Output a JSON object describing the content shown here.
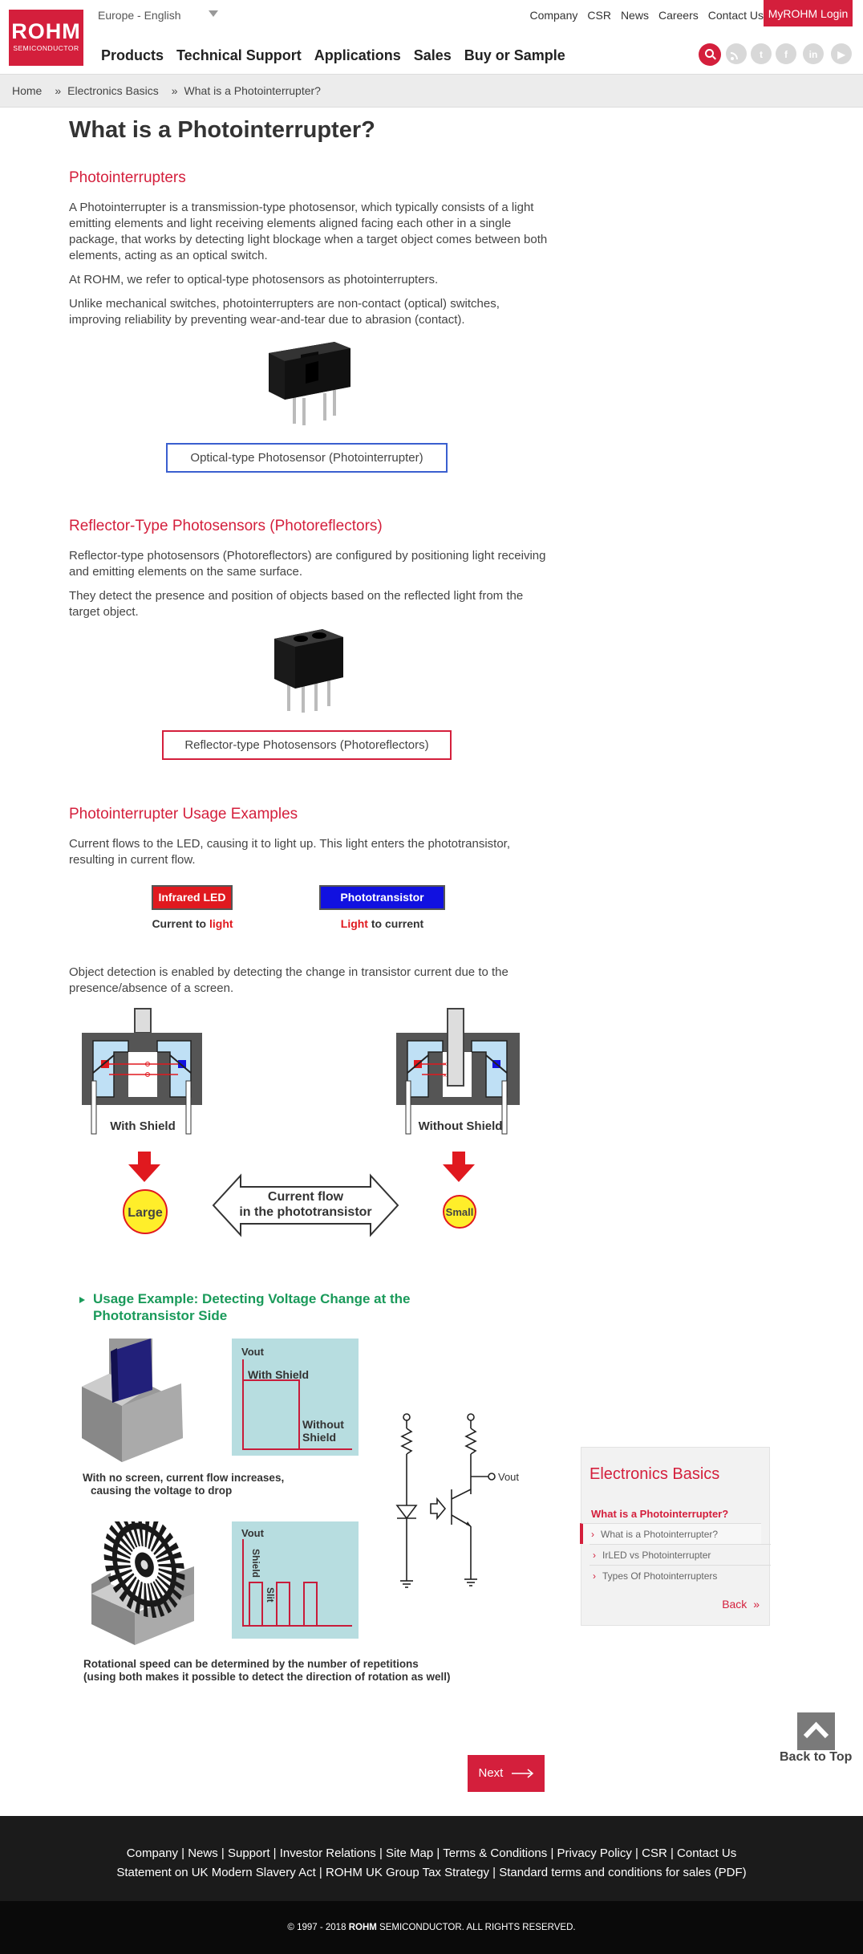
{
  "header": {
    "logo": {
      "brand": "ROHM",
      "sub": "SEMICONDUCTOR"
    },
    "region": "Europe - English",
    "top_links": [
      "Company",
      "CSR",
      "News",
      "Careers",
      "Contact Us"
    ],
    "login": "MyROHM Login",
    "nav": [
      "Products",
      "Technical Support",
      "Applications",
      "Sales",
      "Buy or Sample"
    ],
    "icons": [
      "search-icon",
      "rss-icon",
      "twitter-icon",
      "facebook-icon",
      "linkedin-icon",
      "youtube-icon"
    ]
  },
  "breadcrumb": [
    "Home",
    "»",
    "Electronics Basics",
    "»",
    "What is a Photointerrupter?"
  ],
  "page": {
    "title": "What is a Photointerrupter?",
    "s1": {
      "title": "Photointerrupters",
      "p1": "A Photointerrupter is a transmission-type photosensor, which typically consists of a light emitting elements and light receiving elements aligned facing each other in a single package, that works by detecting light blockage when a target object comes between both elements, acting as an optical switch.",
      "p2": "At ROHM, we refer to optical-type photosensors as photointerrupters.",
      "p3": "Unlike mechanical switches, photointerrupters are non-contact (optical) switches, improving reliability by preventing wear-and-tear due to abrasion (contact).",
      "caption": "Optical-type Photosensor (Photointerrupter)"
    },
    "s2": {
      "title": "Reflector-Type Photosensors (Photoreflectors)",
      "p1": "Reflector-type photosensors (Photoreflectors) are configured by positioning light receiving and emitting elements on the same surface.",
      "p2": "They detect the presence and position of objects based on the reflected light from the target object.",
      "caption": "Reflector-type Photosensors (Photoreflectors)"
    },
    "s3": {
      "title": "Photointerrupter Usage Examples",
      "p1": "Current flows to the LED, causing it to light up. This light enters the phototransistor, resulting in current flow.",
      "led_label": "Infrared LED",
      "led_sub_a": "Current to",
      "led_sub_b": "light",
      "pt_label": "Phototransistor",
      "pt_sub_a": "Light",
      "pt_sub_b": "to current",
      "p2": "Object detection is enabled by detecting the change in transistor current due to the presence/absence of a screen.",
      "with_shield": "With Shield",
      "without_shield": "Without Shield",
      "large": "Large",
      "small": "Small",
      "flow_line1": "Current flow",
      "flow_line2": "in the phototransistor"
    },
    "s4": {
      "title_line1": "Usage Example: Detecting Voltage Change at the",
      "title_line2": "Phototransistor Side",
      "vout": "Vout",
      "graph_with": "With Shield",
      "graph_without_1": "Without",
      "graph_without_2": "Shield",
      "cap1_line1": "With no screen, current flow increases,",
      "cap1_line2": "causing the voltage to drop",
      "graph2_shield": "Shield",
      "graph2_slit": "Slit",
      "circuit_vout": "Vout",
      "cap2_line1": "Rotational speed can be determined by the number of repetitions",
      "cap2_line2": "(using both makes it possible to detect the direction of rotation as well)"
    },
    "next": "Next"
  },
  "sidebar": {
    "title": "Electronics Basics",
    "current": "What is a Photointerrupter?",
    "items": [
      "What is a Photointerrupter?",
      "IrLED vs Photointerrupter",
      "Types Of Photointerrupters"
    ],
    "back": "Back"
  },
  "back_to_top": "Back to Top",
  "footer": {
    "row1": [
      "Company",
      "News",
      "Support",
      "Investor Relations",
      "Site Map",
      "Terms & Conditions",
      "Privacy Policy",
      "CSR",
      "Contact Us"
    ],
    "row2": [
      "Statement on UK Modern Slavery Act",
      "ROHM UK Group Tax Strategy",
      "Standard terms and conditions for sales (PDF)"
    ],
    "copyright_a": "© 1997 - 2018",
    "copyright_b": "ROHM",
    "copyright_c": "SEMICONDUCTOR. ALL RIGHTS RESERVED."
  },
  "colors": {
    "brand": "#d41f3c",
    "accent_green": "#1a9a5a",
    "led_red": "#e0191f",
    "pt_blue": "#1111e0"
  }
}
